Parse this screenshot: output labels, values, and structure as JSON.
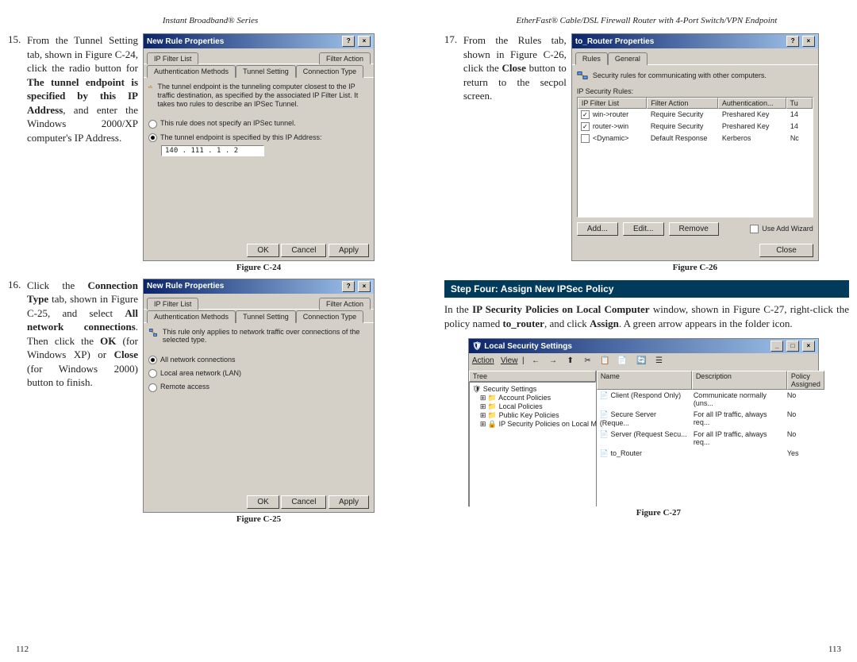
{
  "left_page": {
    "header": "Instant Broadband® Series",
    "footer_page": "112",
    "item15": {
      "num": "15.",
      "text_parts": [
        "From the Tunnel Setting tab, shown in Figure C-24, click the radio button for ",
        "The tunnel endpoint is specified by this IP Address",
        ", and enter the Windows 2000/XP computer's IP Address."
      ]
    },
    "item16": {
      "num": "16.",
      "text_parts": [
        "Click the ",
        "Connection Type",
        " tab, shown in Figure C-25, and select ",
        "All network connections",
        ". Then click the ",
        "OK",
        " (for Windows XP) or ",
        "Close",
        " (for Windows 2000) button to finish."
      ]
    },
    "fig_c24": {
      "caption": "Figure C-24",
      "title": "New Rule Properties",
      "tabs": [
        "IP Filter List",
        "Filter Action",
        "Authentication Methods",
        "Tunnel Setting",
        "Connection Type"
      ],
      "active_tab": "Tunnel Setting",
      "desc": "The tunnel endpoint is the tunneling computer closest to the IP traffic destination, as specified by the associated IP Filter List. It takes two rules to describe an IPSec Tunnel.",
      "radio1": "This rule does not specify an IPSec tunnel.",
      "radio2": "The tunnel endpoint is specified by this IP Address:",
      "ip_value": "140 . 111 .   1  .   2",
      "buttons": [
        "OK",
        "Cancel",
        "Apply"
      ]
    },
    "fig_c25": {
      "caption": "Figure C-25",
      "title": "New Rule Properties",
      "tabs": [
        "IP Filter List",
        "Filter Action",
        "Authentication Methods",
        "Tunnel Setting",
        "Connection Type"
      ],
      "active_tab": "Connection Type",
      "desc": "This rule only applies to network traffic over connections of the selected type.",
      "radio1": "All network connections",
      "radio2": "Local area network (LAN)",
      "radio3": "Remote access",
      "buttons": [
        "OK",
        "Cancel",
        "Apply"
      ]
    }
  },
  "right_page": {
    "header": "EtherFast® Cable/DSL Firewall Router with 4-Port Switch/VPN Endpoint",
    "footer_page": "113",
    "item17": {
      "num": "17.",
      "text_parts": [
        "From the Rules tab, shown in Figure C-26, click the ",
        "Close",
        " button to return to the secpol screen."
      ]
    },
    "fig_c26": {
      "caption": "Figure C-26",
      "title": "to_Router Properties",
      "tabs": [
        "Rules",
        "General"
      ],
      "active_tab": "Rules",
      "desc": "Security rules for communicating with other computers.",
      "group_label": "IP Security Rules:",
      "columns": [
        "IP Filter List",
        "Filter Action",
        "Authentication...",
        "Tu"
      ],
      "rows": [
        [
          "win->router",
          "Require Security",
          "Preshared Key",
          "14"
        ],
        [
          "router->win",
          "Require Security",
          "Preshared Key",
          "14"
        ],
        [
          "<Dynamic>",
          "Default Response",
          "Kerberos",
          "Nc"
        ]
      ],
      "row_checked": [
        true,
        true,
        false
      ],
      "buttons": [
        "Add...",
        "Edit...",
        "Remove"
      ],
      "use_wizard": "Use Add Wizard",
      "close_btn": "Close"
    },
    "step_header": "Step Four: Assign New IPSec Policy",
    "step_para_parts": [
      "In the ",
      "IP Security Policies on Local Computer",
      " window, shown in Figure C-27, right-click the policy named ",
      "to_router",
      ", and click ",
      "Assign",
      ". A green arrow appears in the folder icon."
    ],
    "fig_c27": {
      "caption": "Figure C-27",
      "title": "Local Security Settings",
      "menu": [
        "Action",
        "View"
      ],
      "tree": [
        "Security Settings",
        "Account Policies",
        "Local Policies",
        "Public Key Policies",
        "IP Security Policies on Local Machine"
      ],
      "columns": [
        "Name",
        "Description",
        "Policy Assigned"
      ],
      "rows": [
        [
          "Client (Respond Only)",
          "Communicate normally (uns...",
          "No"
        ],
        [
          "Secure Server (Reque...",
          "For all IP traffic, always req...",
          "No"
        ],
        [
          "Server (Request Secu...",
          "For all IP traffic, always req...",
          "No"
        ],
        [
          "to_Router",
          "",
          "Yes"
        ]
      ],
      "tree_header": "Tree"
    }
  }
}
